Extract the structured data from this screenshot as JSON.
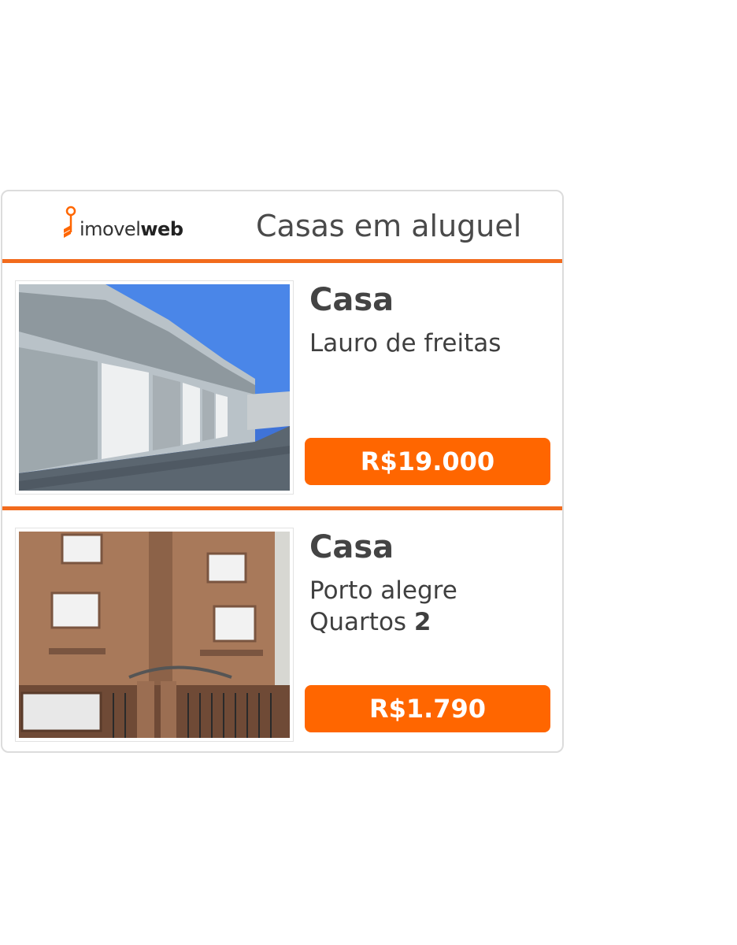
{
  "header": {
    "logo": {
      "prefix": "imovel",
      "suffix": "web"
    },
    "title": "Casas em aluguel"
  },
  "colors": {
    "accent": "#ff6600",
    "rule": "#f26b1d"
  },
  "listings": [
    {
      "image": "warehouse-photo",
      "type": "Casa",
      "location": "Lauro de freitas",
      "rooms_label": "",
      "rooms_value": "",
      "price": "R$19.000"
    },
    {
      "image": "apartment-building-photo",
      "type": "Casa",
      "location": "Porto alegre",
      "rooms_label": "Quartos",
      "rooms_value": "2",
      "price": "R$1.790"
    }
  ]
}
